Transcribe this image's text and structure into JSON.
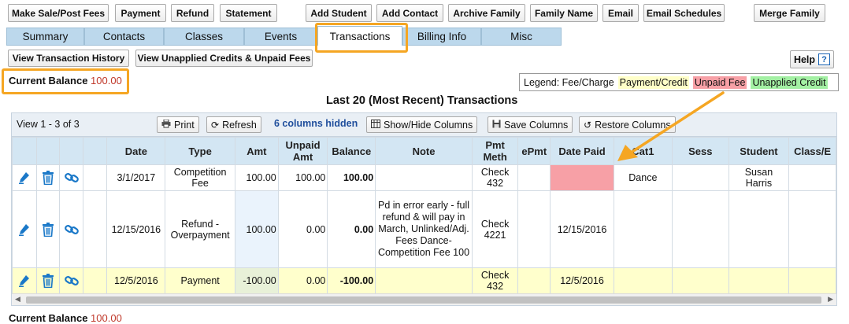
{
  "top_buttons": {
    "make_sale": "Make Sale/Post Fees",
    "payment": "Payment",
    "refund": "Refund",
    "statement": "Statement",
    "add_student": "Add Student",
    "add_contact": "Add Contact",
    "archive_family": "Archive Family",
    "family_name": "Family Name",
    "email": "Email",
    "email_schedules": "Email Schedules",
    "merge_family": "Merge Family"
  },
  "tabs": [
    "Summary",
    "Contacts",
    "Classes",
    "Events",
    "Transactions",
    "Billing Info",
    "Misc"
  ],
  "active_tab": "Transactions",
  "sub_buttons": {
    "history": "View Transaction History",
    "unapplied": "View Unapplied Credits & Unpaid Fees",
    "help": "Help",
    "help_icon": "?"
  },
  "balance": {
    "label": "Current Balance",
    "value": "100.00"
  },
  "legend": {
    "prefix": "Legend: Fee/Charge",
    "payment": "Payment/Credit",
    "unpaid": "Unpaid Fee",
    "credit": "Unapplied Credit",
    "colors": {
      "payment": "#ffffc8",
      "unpaid": "#f7a0a6",
      "credit": "#a3f0a3"
    }
  },
  "grid": {
    "title": "Last 20 (Most Recent) Transactions",
    "view_count": "View 1 - 3 of 3",
    "print": "Print",
    "refresh": "Refresh",
    "hidden_cols": "6 columns hidden",
    "show_hide": "Show/Hide Columns",
    "save_cols": "Save Columns",
    "restore_cols": "Restore Columns",
    "headers": {
      "date": "Date",
      "type": "Type",
      "amt": "Amt",
      "unpaid_amt": "Unpaid Amt",
      "balance": "Balance",
      "note": "Note",
      "pmt_meth": "Pmt Meth",
      "epmt": "ePmt",
      "date_paid": "Date Paid",
      "cat1": "Cat1",
      "sess": "Sess",
      "student": "Student",
      "class": "Class/E"
    },
    "rows": [
      {
        "date": "3/1/2017",
        "type": "Competition Fee",
        "amt": "100.00",
        "unpaid": "100.00",
        "balance": "100.00",
        "note": "",
        "pmt": "Check 432",
        "epmt": "",
        "date_paid": "",
        "cat1": "Dance",
        "sess": "",
        "student": "Susan Harris",
        "class": ""
      },
      {
        "date": "12/15/2016",
        "type": "Refund - Overpayment",
        "amt": "100.00",
        "unpaid": "0.00",
        "balance": "0.00",
        "note": "Pd in error early - full refund & will pay in March, Unlinked/Adj. Fees Dance-Competition Fee 100",
        "pmt": "Check 4221",
        "epmt": "",
        "date_paid": "12/15/2016",
        "cat1": "",
        "sess": "",
        "student": "",
        "class": ""
      },
      {
        "date": "12/5/2016",
        "type": "Payment",
        "amt": "-100.00",
        "unpaid": "0.00",
        "balance": "-100.00",
        "note": "",
        "pmt": "Check 432",
        "epmt": "",
        "date_paid": "12/5/2016",
        "cat1": "",
        "sess": "",
        "student": "",
        "class": ""
      }
    ]
  },
  "colors": {
    "accent_orange": "#f5a623",
    "tab_blue": "#bcd8ec",
    "header_blue": "#d3e6f3",
    "balance_red": "#c0392b"
  }
}
